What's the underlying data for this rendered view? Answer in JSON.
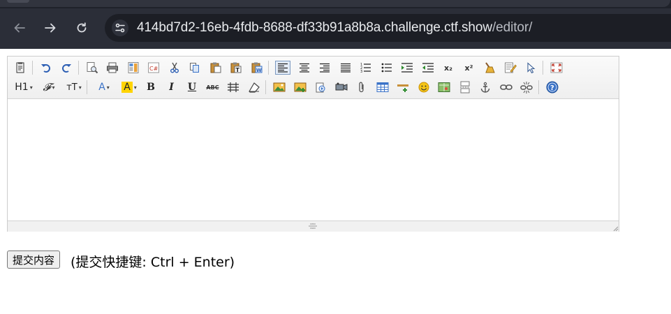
{
  "browser": {
    "url_host": "414bd7d2-16eb-4fdb-8688-df33b91a8b8a.challenge.ctf.show",
    "url_path": "/editor/",
    "nav": [
      "back-arrow-icon",
      "forward-arrow-icon",
      "reload-icon"
    ],
    "site_info_icon": "tune-icon"
  },
  "editor": {
    "toolbar_row1": [
      "source-code-icon",
      "undo-icon",
      "redo-icon",
      "preview-icon",
      "print-icon",
      "template-icon",
      "code-snippet-icon",
      "cut-icon",
      "copy-icon",
      "paste-icon",
      "paste-text-icon",
      "paste-word-icon",
      "align-left-icon",
      "align-center-icon",
      "align-right-icon",
      "align-justify-icon",
      "ordered-list-icon",
      "unordered-list-icon",
      "indent-icon",
      "outdent-icon",
      "subscript-icon",
      "superscript-icon",
      "clear-format-icon",
      "quick-format-icon",
      "select-all-icon",
      "fullscreen-icon"
    ],
    "toolbar_row2": [
      "heading-dropdown",
      "font-family-dropdown",
      "font-size-dropdown",
      "font-color-dropdown",
      "highlight-color-dropdown",
      "bold-icon",
      "italic-icon",
      "underline-icon",
      "strikethrough-icon",
      "line-height-icon",
      "remove-format-icon",
      "image-icon",
      "multi-image-icon",
      "flash-icon",
      "media-icon",
      "attachment-icon",
      "table-icon",
      "horizontal-rule-icon",
      "emoticon-icon",
      "map-icon",
      "page-break-icon",
      "anchor-icon",
      "link-icon",
      "unlink-icon",
      "help-icon"
    ],
    "labels": {
      "heading": "H1",
      "font_family": "𝓕",
      "font_size": "тT",
      "font_color": "A",
      "highlight": "A",
      "bold": "B",
      "italic": "I",
      "underline": "U",
      "strike": "ABC",
      "subscript": "x₂",
      "superscript": "x²"
    },
    "content": ""
  },
  "form": {
    "submit_label": "提交内容",
    "shortcut_hint": "(提交快捷键: Ctrl + Enter)"
  },
  "colors": {
    "chrome_bg": "#2b2e38",
    "omnibox_bg": "#1c1e25",
    "accent_blue": "#3b73c8",
    "font_color_red": "#d0021b",
    "highlight_yellow": "#ffd400"
  }
}
